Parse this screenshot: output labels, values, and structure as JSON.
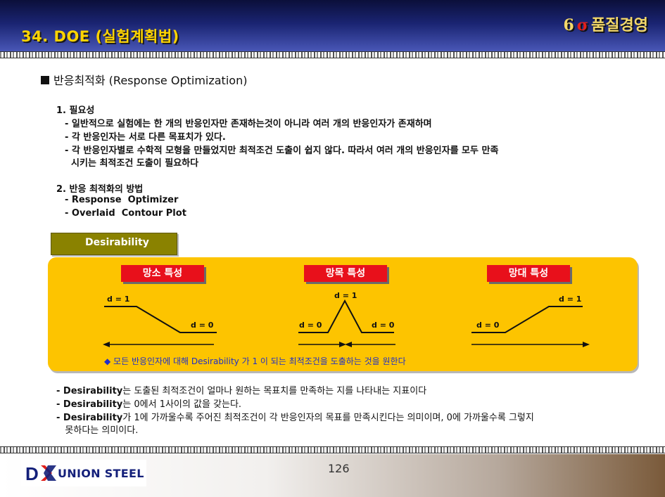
{
  "header": {
    "title": "34. DOE (실험계획법)",
    "brand_number": "6",
    "brand_sigma": "σ",
    "brand_text": "품질경영"
  },
  "section_title": "반응최적화 (Response Optimization)",
  "need": {
    "heading": "1. 필요성",
    "lines": [
      "- 일반적으로 실험에는 한 개의 반응인자만 존재하는것이 아니라 여러 개의 반응인자가 존재하며",
      "- 각 반응인자는 서로 다른 목표치가 있다.",
      "- 각 반응인자별로 수학적 모형을 만들었지만 최적조건 도출이 쉽지 않다.  따라서 여러 개의 반응인자를 모두 만족",
      "  시키는 최적조건 도출이 필요하다"
    ]
  },
  "methods": {
    "heading": "2. 반응 최적화의 방법",
    "items": [
      "- Response  Optimizer",
      "- Overlaid  Contour Plot"
    ]
  },
  "tab_label": "Desirability",
  "panel": {
    "labels": [
      "망소 특성",
      "망목 특성",
      "망대 특성"
    ],
    "smaller": {
      "d1": "d = 1",
      "d0": "d = 0"
    },
    "target": {
      "d1": "d = 1",
      "d0_left": "d = 0",
      "d0_right": "d = 0"
    },
    "larger": {
      "d0": "d = 0",
      "d1": "d = 1"
    },
    "note": "◆ 모든 반응인자에 대해 Desirability 가 1 이 되는 최적조건을 도출하는 것을 원한다"
  },
  "desc": [
    {
      "b": "- Desirability",
      "t": "는  도출된 최적조건이 얼마나 원하는 목표치를 만족하는 지를 나타내는 지표이다"
    },
    {
      "b": "- Desirability",
      "t": "는  0에서 1사이의 값을 갖는다."
    },
    {
      "b": "- Desirability",
      "t": "가  1에 가까울수록 주어진 최적조건이 각 반응인자의 목표를 만족시킨다는 의미이며, 0에 가까울수록 그렇지"
    },
    {
      "b": "",
      "t": "   못하다는 의미이다."
    }
  ],
  "footer": {
    "company": "UNION STEEL",
    "page_number": "126"
  }
}
